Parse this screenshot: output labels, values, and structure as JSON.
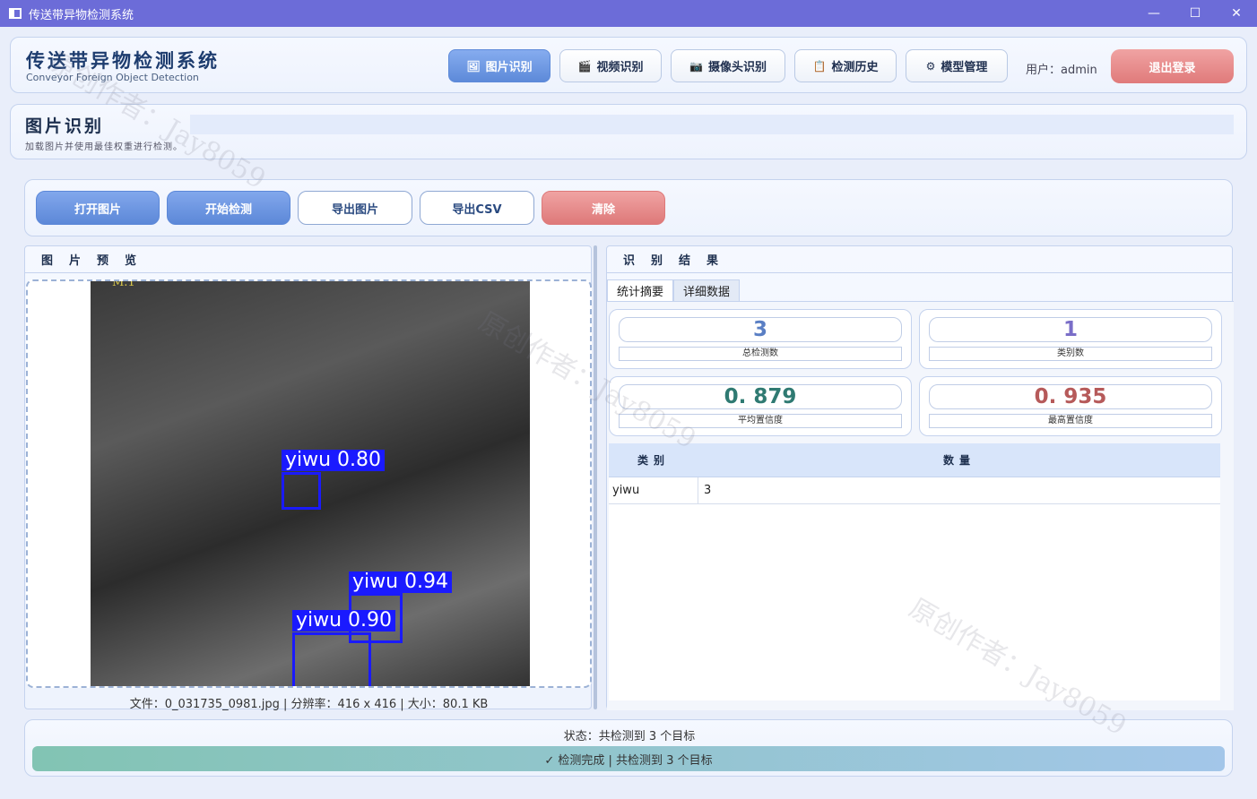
{
  "window": {
    "title": "传送带异物检测系统",
    "controls": {
      "minimize": "—",
      "maximize": "☐",
      "close": "✕"
    }
  },
  "header": {
    "brand_title": "传送带异物检测系统",
    "brand_subtitle": "Conveyor Foreign Object Detection",
    "nav": [
      {
        "label": "图片识别",
        "icon": "🖼",
        "active": true
      },
      {
        "label": "视频识别",
        "icon": "🎬",
        "active": false
      },
      {
        "label": "摄像头识别",
        "icon": "📷",
        "active": false
      },
      {
        "label": "检测历史",
        "icon": "📋",
        "active": false
      },
      {
        "label": "模型管理",
        "icon": "⚙",
        "active": false
      }
    ],
    "user_label": "用户：admin",
    "logout_label": "退出登录"
  },
  "page": {
    "title": "图片识别",
    "subtitle": "加载图片并使用最佳权重进行检测。"
  },
  "toolbar": {
    "open_image": "打开图片",
    "start_detect": "开始检测",
    "export_image": "导出图片",
    "export_csv": "导出CSV",
    "clear": "清除"
  },
  "preview": {
    "header": "图片预览",
    "file_info": "文件：0_031735_0981.jpg | 分辨率：416 x 416 | 大小：80.1 KB",
    "image_corner_label": "M.1",
    "detections": [
      {
        "label": "yiwu 0.80",
        "class": "yiwu",
        "confidence": 0.8
      },
      {
        "label": "yiwu 0.94",
        "class": "yiwu",
        "confidence": 0.94
      },
      {
        "label": "yiwu 0.90",
        "class": "yiwu",
        "confidence": 0.9
      }
    ]
  },
  "results": {
    "header": "识别结果",
    "tabs": [
      {
        "label": "统计摘要",
        "active": true
      },
      {
        "label": "详细数据",
        "active": false
      }
    ],
    "stats": [
      {
        "value": "3",
        "label": "总检测数",
        "color": "#5a7fc4"
      },
      {
        "value": "1",
        "label": "类别数",
        "color": "#7a6ec8"
      },
      {
        "value": "0. 879",
        "label": "平均置信度",
        "color": "#2f7a72"
      },
      {
        "value": "0. 935",
        "label": "最高置信度",
        "color": "#b65a5a"
      }
    ],
    "table": {
      "columns": [
        "类别",
        "数量"
      ],
      "rows": [
        [
          "yiwu",
          "3"
        ]
      ]
    }
  },
  "status": {
    "text": "状态：共检测到 3 个目标",
    "progress_text": "✓ 检测完成 | 共检测到 3 个目标"
  },
  "watermark": "原创作者：Jay8059"
}
